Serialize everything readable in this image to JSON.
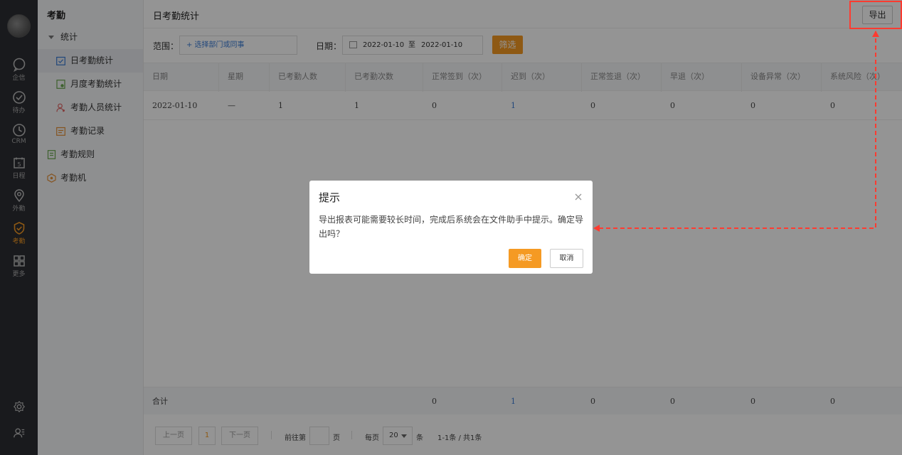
{
  "rail": {
    "items": [
      {
        "label": "企信",
        "icon": "chat-icon"
      },
      {
        "label": "待办",
        "icon": "check-circle-icon"
      },
      {
        "label": "CRM",
        "icon": "clock-icon"
      },
      {
        "label": "日程",
        "icon": "calendar-icon",
        "day": "5"
      },
      {
        "label": "外勤",
        "icon": "location-pin-icon"
      },
      {
        "label": "考勤",
        "icon": "attendance-icon",
        "active": true
      },
      {
        "label": "更多",
        "icon": "grid-icon"
      }
    ],
    "accent": "#f59a23"
  },
  "subnav": {
    "title": "考勤",
    "group": "统计",
    "items": [
      {
        "label": "日考勤统计",
        "active": true
      },
      {
        "label": "月度考勤统计"
      },
      {
        "label": "考勤人员统计"
      },
      {
        "label": "考勤记录"
      },
      {
        "label": "考勤规则"
      },
      {
        "label": "考勤机"
      }
    ]
  },
  "header": {
    "title": "日考勤统计",
    "export_label": "导出"
  },
  "filter": {
    "scope_label": "范围：",
    "scope_placeholder": "+ 选择部门或同事",
    "date_label": "日期：",
    "date_from": "2022-01-10",
    "date_sep": "至",
    "date_to": "2022-01-10",
    "filter_button": "筛选"
  },
  "table": {
    "columns": [
      "日期",
      "星期",
      "已考勤人数",
      "已考勤次数",
      "正常签到（次）",
      "迟到（次）",
      "正常签退（次）",
      "早退（次）",
      "设备异常（次）",
      "系统风险（次）"
    ],
    "rows": [
      [
        "2022-01-10",
        "—",
        "1",
        "1",
        "0",
        "1",
        "0",
        "0",
        "0",
        "0"
      ]
    ],
    "total": {
      "label": "合计",
      "values": [
        "0",
        "1",
        "0",
        "0",
        "0",
        "0"
      ]
    }
  },
  "pager": {
    "prev": "上一页",
    "page": "1",
    "next": "下一页",
    "goto_prefix": "前往第",
    "goto_suffix": "页",
    "per_page_label": "每页",
    "per_page_value": "20",
    "per_page_unit": "条",
    "summary": "1-1条 / 共1条"
  },
  "dialog": {
    "title": "提示",
    "message": "导出报表可能需要较长时间，完成后系统会在文件助手中提示。确定导出吗？",
    "confirm": "确定",
    "cancel": "取消"
  },
  "annotation_color": "#ff3b30"
}
